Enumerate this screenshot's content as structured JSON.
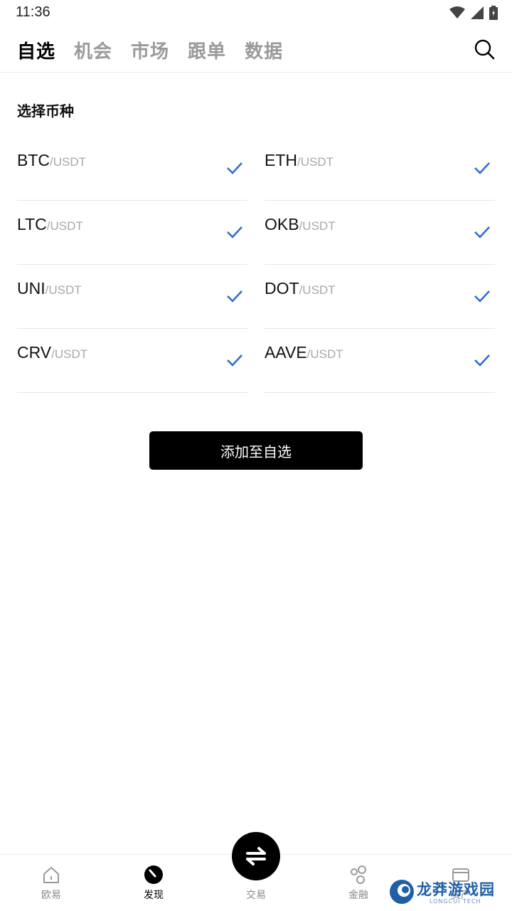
{
  "status_bar": {
    "time": "11:36"
  },
  "header": {
    "tabs": [
      {
        "label": "自选",
        "active": true
      },
      {
        "label": "机会",
        "active": false
      },
      {
        "label": "市场",
        "active": false
      },
      {
        "label": "跟单",
        "active": false
      },
      {
        "label": "数据",
        "active": false
      }
    ],
    "search_icon": "search-icon"
  },
  "section": {
    "title": "选择币种"
  },
  "coins": [
    {
      "base": "BTC",
      "quote": "/USDT",
      "selected": true
    },
    {
      "base": "ETH",
      "quote": "/USDT",
      "selected": true
    },
    {
      "base": "LTC",
      "quote": "/USDT",
      "selected": true
    },
    {
      "base": "OKB",
      "quote": "/USDT",
      "selected": true
    },
    {
      "base": "UNI",
      "quote": "/USDT",
      "selected": true
    },
    {
      "base": "DOT",
      "quote": "/USDT",
      "selected": true
    },
    {
      "base": "CRV",
      "quote": "/USDT",
      "selected": true
    },
    {
      "base": "AAVE",
      "quote": "/USDT",
      "selected": true
    }
  ],
  "add_button": {
    "label": "添加至自选"
  },
  "bottom_nav": {
    "items": [
      {
        "label": "欧易",
        "icon": "home-icon"
      },
      {
        "label": "发现",
        "icon": "discover-icon",
        "active": true
      },
      {
        "label": "交易",
        "icon": "trade-swap-icon"
      },
      {
        "label": "金融",
        "icon": "finance-icon"
      },
      {
        "label": "资产",
        "icon": "wallet-icon"
      }
    ]
  },
  "watermark": {
    "text": "龙莽游戏园",
    "sub": "LONGCUI TECH"
  },
  "colors": {
    "accent_check": "#2f6fd1",
    "primary_button": "#000000"
  }
}
